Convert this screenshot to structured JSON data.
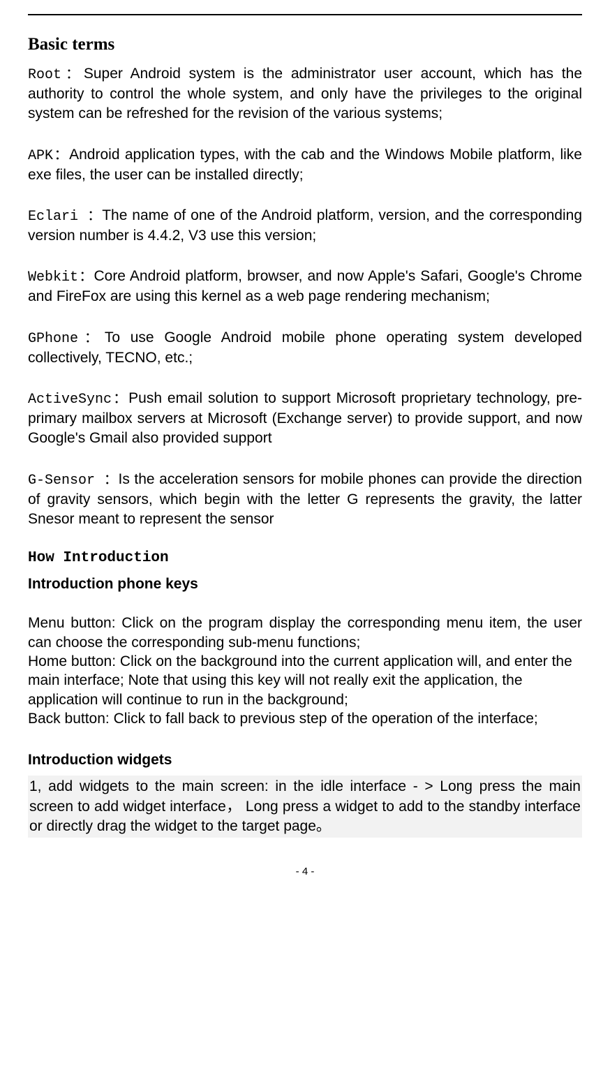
{
  "heading": "Basic terms",
  "terms": {
    "root": {
      "label": "Root：",
      "text": "Super Android system is the administrator user account, which has the authority to control the whole system, and only have the privileges to the original system can be refreshed for the revision of the various systems;"
    },
    "apk": {
      "label": "APK：",
      "text": "Android application types, with the cab and the Windows Mobile platform, like exe files, the user can be installed directly;"
    },
    "eclari": {
      "label": "Eclari ：",
      "text": "The name of one of the Android platform, version, and the corresponding version number is 4.4.2, V3   use this version;"
    },
    "webkit": {
      "label": "Webkit：",
      "text": "Core Android platform, browser, and now Apple's Safari, Google's Chrome and FireFox are using this kernel as a web page rendering mechanism;"
    },
    "gphone": {
      "label": "GPhone：",
      "text": "To use Google Android mobile phone operating system developed collectively, TECNO, etc.;"
    },
    "activesync": {
      "label": "ActiveSync：",
      "text": "Push email solution to support Microsoft proprietary technology, pre-primary mailbox servers at Microsoft (Exchange server) to provide support, and now Google's Gmail also provided support"
    },
    "gsensor": {
      "label": "G-Sensor ：",
      "text": "Is the acceleration sensors for mobile phones can provide the direction of gravity sensors, which begin with the letter G represents the gravity, the latter Snesor meant to represent the sensor"
    }
  },
  "section2": {
    "title": "How Introduction",
    "sub1": "Introduction phone keys",
    "p1": "Menu button: Click on the program display the corresponding menu item, the user can choose the corresponding sub-menu functions;",
    "p2": "Home button: Click on the background into the current application will, and enter the main interface; Note that using this key will not really exit the application, the application will continue to run in the background;",
    "p3": "Back button: Click to fall back to previous step of the operation of the interface;",
    "sub2": "Introduction widgets",
    "highlight": "1, add widgets to the main screen: in the idle interface - > Long press the main screen to add widget interface， Long press a widget to add to the standby interface or directly drag the widget to the target page。"
  },
  "footer": "- 4 -"
}
